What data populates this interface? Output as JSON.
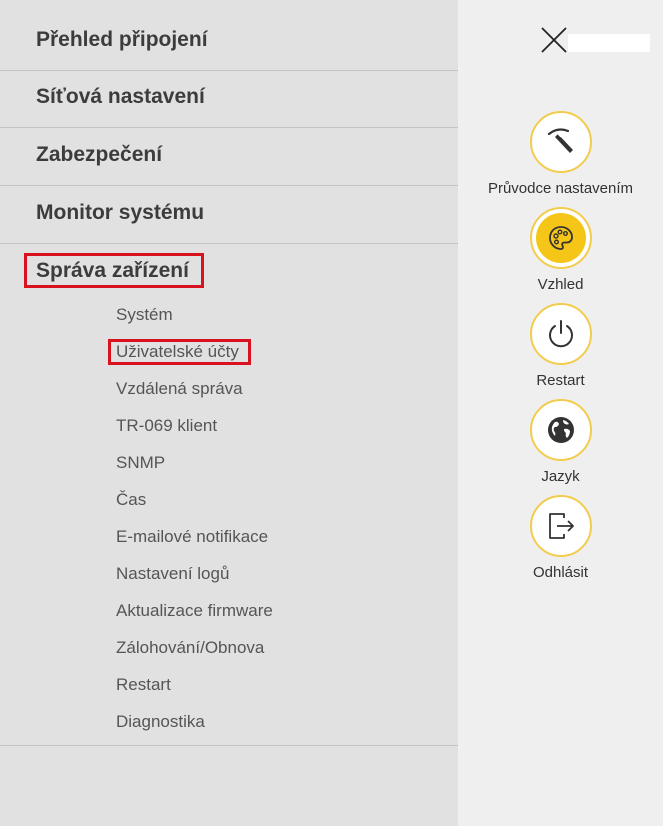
{
  "main_menu": [
    {
      "label": "Přehled připojení"
    },
    {
      "label": "Síťová nastavení"
    },
    {
      "label": "Zabezpečení"
    },
    {
      "label": "Monitor systému"
    },
    {
      "label": "Správa zařízení",
      "active": true
    }
  ],
  "sub_menu": [
    {
      "label": "Systém"
    },
    {
      "label": "Uživatelské účty",
      "active": true
    },
    {
      "label": "Vzdálená správa"
    },
    {
      "label": "TR-069 klient"
    },
    {
      "label": "SNMP"
    },
    {
      "label": "Čas"
    },
    {
      "label": "E-mailové notifikace"
    },
    {
      "label": "Nastavení logů"
    },
    {
      "label": "Aktualizace firmware"
    },
    {
      "label": "Zálohování/Obnova"
    },
    {
      "label": "Restart"
    },
    {
      "label": "Diagnostika"
    }
  ],
  "actions": [
    {
      "label": "Průvodce nastavením",
      "icon": "wizard-wand-icon"
    },
    {
      "label": "Vzhled",
      "icon": "palette-icon"
    },
    {
      "label": "Restart",
      "icon": "power-icon"
    },
    {
      "label": "Jazyk",
      "icon": "globe-icon"
    },
    {
      "label": "Odhlásit",
      "icon": "logout-icon"
    }
  ],
  "colors": {
    "highlight": "#d9121f",
    "accent": "#f5c518",
    "accent_border": "#f2cc4c"
  }
}
